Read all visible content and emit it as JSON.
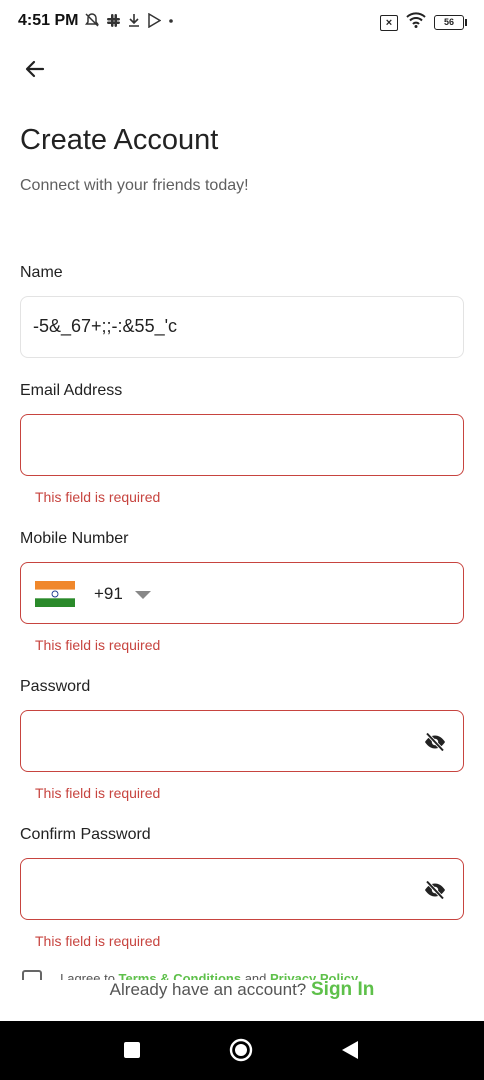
{
  "status_bar": {
    "time": "4:51 PM",
    "battery": "56",
    "icons_left": [
      "do-not-disturb-icon",
      "slack-icon",
      "download-icon",
      "play-store-icon",
      "dot-icon"
    ],
    "icons_right": [
      "x-box-icon",
      "wifi-icon",
      "battery-icon"
    ]
  },
  "header": {
    "title": "Create Account",
    "subtitle": "Connect with your friends today!"
  },
  "form": {
    "name": {
      "label": "Name",
      "value": "-5&_67+;;-:&55_'c"
    },
    "email": {
      "label": "Email Address",
      "value": "",
      "error": "This field is required"
    },
    "mobile": {
      "label": "Mobile Number",
      "country_code": "+91",
      "flag": "india-flag",
      "value": "",
      "error": "This field is required"
    },
    "password": {
      "label": "Password",
      "value": "",
      "error": "This field is required"
    },
    "confirm_password": {
      "label": "Confirm Password",
      "value": "",
      "error": "This field is required"
    },
    "terms": {
      "prefix": "I agree to ",
      "terms_link": "Terms & Conditions",
      "and": " and ",
      "privacy_link": "Privacy Policy"
    }
  },
  "footer": {
    "prompt": "Already have an account?",
    "signin_label": "Sign In"
  },
  "colors": {
    "error": "#c7443f",
    "accent": "#5ec04a",
    "nav_bar": "#000000"
  }
}
